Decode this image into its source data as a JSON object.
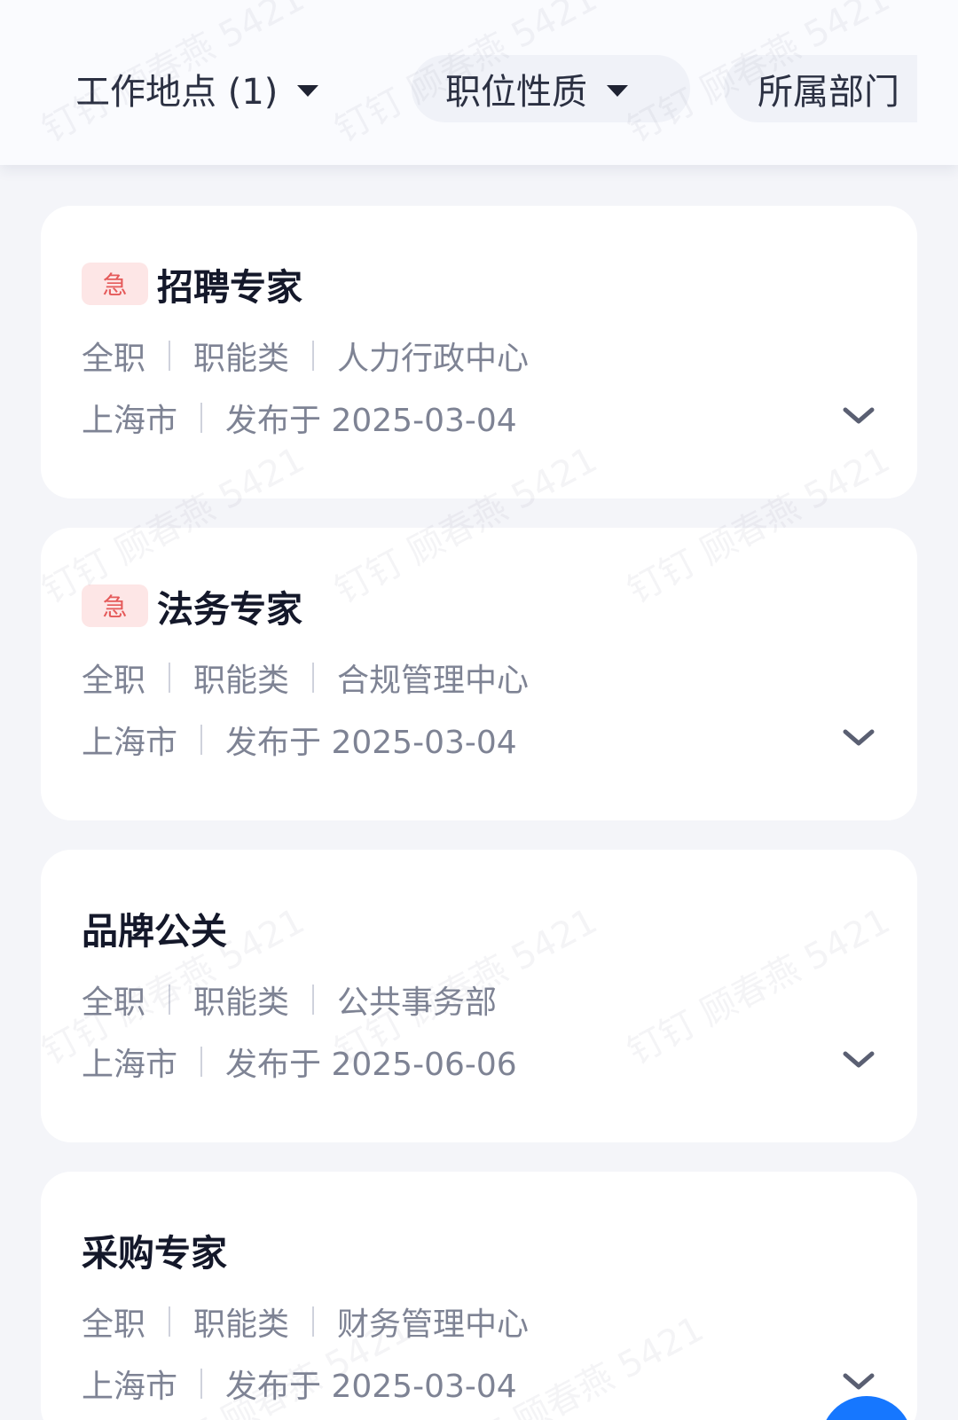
{
  "filters": [
    {
      "label": "工作地点 (1)",
      "has_caret": true
    },
    {
      "label": "职位性质",
      "has_caret": true
    },
    {
      "label": "所属部门",
      "has_caret": false
    }
  ],
  "jobs": [
    {
      "urgent_label": "急",
      "title": "招聘专家",
      "type": "全职",
      "category": "职能类",
      "department": "人力行政中心",
      "city": "上海市",
      "published": "发布于 2025-03-04",
      "urgent": true
    },
    {
      "urgent_label": "急",
      "title": "法务专家",
      "type": "全职",
      "category": "职能类",
      "department": "合规管理中心",
      "city": "上海市",
      "published": "发布于 2025-03-04",
      "urgent": true
    },
    {
      "urgent_label": "",
      "title": "品牌公关",
      "type": "全职",
      "category": "职能类",
      "department": "公共事务部",
      "city": "上海市",
      "published": "发布于 2025-06-06",
      "urgent": false
    },
    {
      "urgent_label": "",
      "title": "采购专家",
      "type": "全职",
      "category": "职能类",
      "department": "财务管理中心",
      "city": "上海市",
      "published": "发布于 2025-03-04",
      "urgent": false
    }
  ],
  "watermark": "钉钉 顾春燕 5421",
  "colors": {
    "accent": "#1677ff",
    "urgent_bg": "#fde6e6",
    "urgent_text": "#e55a5a"
  },
  "icons": {
    "expand": "chevron-down-icon",
    "filter_caret": "caret-down-icon"
  }
}
